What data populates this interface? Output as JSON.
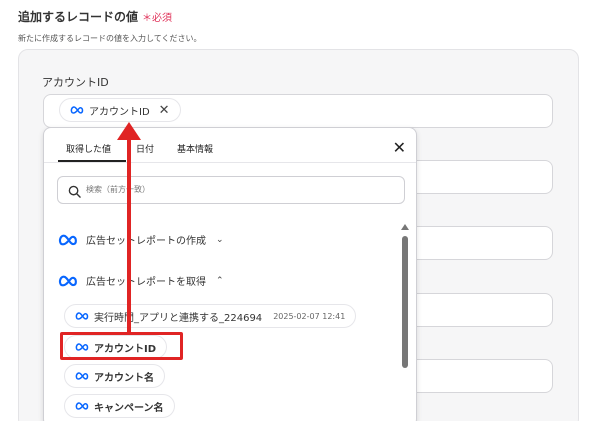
{
  "section": {
    "title": "追加するレコードの値",
    "required": "＊必須",
    "description": "新たに作成するレコードの値を入力してください。"
  },
  "field": {
    "label": "アカウントID",
    "chip": "アカウントID"
  },
  "popup": {
    "tabs": [
      "取得した値",
      "日付",
      "基本情報"
    ],
    "search_placeholder": "検索（前方一致）",
    "groups": [
      "広告セットレポートの作成",
      "広告セットレポートを取得"
    ],
    "items": [
      {
        "label": "実行時間_アプリと連携する_224694",
        "date": "2025-02-07 12:41"
      },
      {
        "label": "アカウントID"
      },
      {
        "label": "アカウント名"
      },
      {
        "label": "キャンペーン名"
      }
    ]
  },
  "colors": {
    "accent": "#e02424",
    "required": "#e0335a",
    "meta_blue": "#0866ff"
  },
  "icons": {
    "meta": "meta-logo-icon",
    "close": "close-icon",
    "search": "search-icon",
    "chevron_down": "chevron-down-icon",
    "chevron_up": "chevron-up-icon"
  }
}
